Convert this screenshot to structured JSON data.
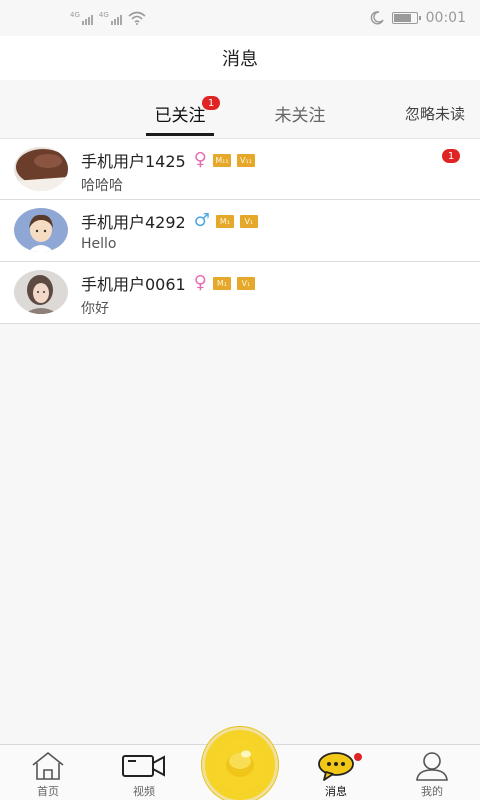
{
  "status_bar": {
    "signal1_label": "4G",
    "signal2_label": "4G",
    "time": "00:01",
    "icons": [
      "signal-icon",
      "wifi-icon",
      "moon-icon",
      "battery-icon"
    ]
  },
  "header": {
    "title": "消息"
  },
  "tabs": {
    "followed": {
      "label": "已关注",
      "badge": "1"
    },
    "unfollowed": {
      "label": "未关注"
    },
    "ignore_unread": {
      "label": "忽略未读"
    }
  },
  "conversations": [
    {
      "name": "手机用户1425",
      "gender": "♀",
      "gender_type": "female",
      "level1": "M₁₁",
      "level2": "V₁₁",
      "preview": "哈哈哈",
      "badge": "1"
    },
    {
      "name": "手机用户4292",
      "gender": "♂",
      "gender_type": "male",
      "level1": "M₁",
      "level2": "V₁",
      "preview": "Hello",
      "badge": ""
    },
    {
      "name": "手机用户0061",
      "gender": "♀",
      "gender_type": "female",
      "level1": "M₁",
      "level2": "V₁",
      "preview": "你好",
      "badge": ""
    }
  ],
  "bottom_nav": {
    "home": {
      "label": "首页",
      "icon": "home-icon"
    },
    "video": {
      "label": "视频",
      "icon": "video-camera-icon"
    },
    "center": {
      "icon": "yellow-orb-icon"
    },
    "messages": {
      "label": "消息",
      "icon": "chat-bubble-icon"
    },
    "me": {
      "label": "我的",
      "icon": "user-icon"
    }
  },
  "colors": {
    "badge": "#e02424",
    "accent_yellow": "#f5d327",
    "female": "#e56fb4",
    "male": "#4da8e0",
    "level_badge": "#e5a82a"
  }
}
